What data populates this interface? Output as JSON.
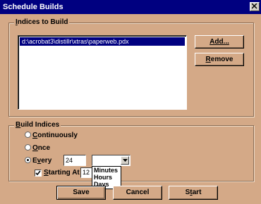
{
  "window": {
    "title": "Schedule Builds"
  },
  "indices": {
    "group_label_prefix": "",
    "group_label_mnemonic": "I",
    "group_label_rest": "ndices to Build",
    "items": [
      "d:\\acrobat3\\distillr\\xtras\\paperweb.pdx"
    ],
    "add_label": "Add...",
    "remove_mnemonic": "R",
    "remove_rest": "emove"
  },
  "build": {
    "group_label_mnemonic": "B",
    "group_label_rest": "uild Indices",
    "options": [
      {
        "mnemonic": "C",
        "rest": "ontinuously",
        "selected": false
      },
      {
        "mnemonic": "O",
        "rest": "nce",
        "selected": false
      },
      {
        "mnemonic": "v",
        "pre": "E",
        "rest": "ery",
        "selected": true
      }
    ],
    "every_value": "24",
    "unit_value": "",
    "starting_checked": true,
    "starting_mnemonic": "S",
    "starting_rest": "tarting At",
    "starting_value": "12",
    "unit_options": [
      "Minutes",
      "Hours",
      "Days"
    ]
  },
  "footer": {
    "save_label": "Save",
    "cancel_label": "Cancel",
    "start_pre": "S",
    "start_mnemonic": "t",
    "start_rest": "art"
  }
}
